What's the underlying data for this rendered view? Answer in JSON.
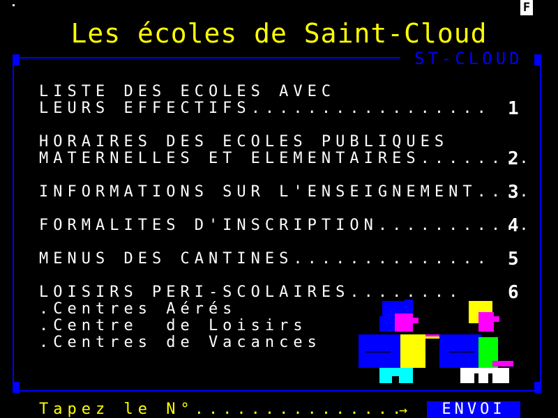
{
  "screen": {
    "title": "Les écoles de Saint-Cloud",
    "station": "ST-CLOUD",
    "status_letter": "F"
  },
  "menu": [
    {
      "line1": "LISTE DES ECOLES AVEC",
      "line2": "LEURS EFFECTIFS",
      "dots": ".................",
      "number": "1"
    },
    {
      "line1": "HORAIRES DES ECOLES PUBLIQUES",
      "line2": "MATERNELLES ET ELEMENTAIRES",
      "dots": "........",
      "number": "2"
    },
    {
      "line1": "INFORMATIONS SUR L'ENSEIGNEMENT",
      "dots": "....",
      "number": "3"
    },
    {
      "line1": "FORMALITES D'INSCRIPTION",
      "dots": "...........",
      "number": "4"
    },
    {
      "line1": "MENUS DES CANTINES",
      "dots": "..............",
      "number": "5"
    },
    {
      "line1": "LOISIRS PERI-SCOLAIRES",
      "dots": "........",
      "number": "6"
    }
  ],
  "sub_items": [
    ".Centres Aérés",
    ".Centre  de Loisirs",
    ".Centres de Vacances"
  ],
  "footer": {
    "prompt": "Tapez le N°...............",
    "arrow": "→",
    "send_label": "ENVOI"
  },
  "colors": {
    "background": "#000000",
    "frame": "#0000ff",
    "title": "#ffff00",
    "text": "#ffffff"
  }
}
